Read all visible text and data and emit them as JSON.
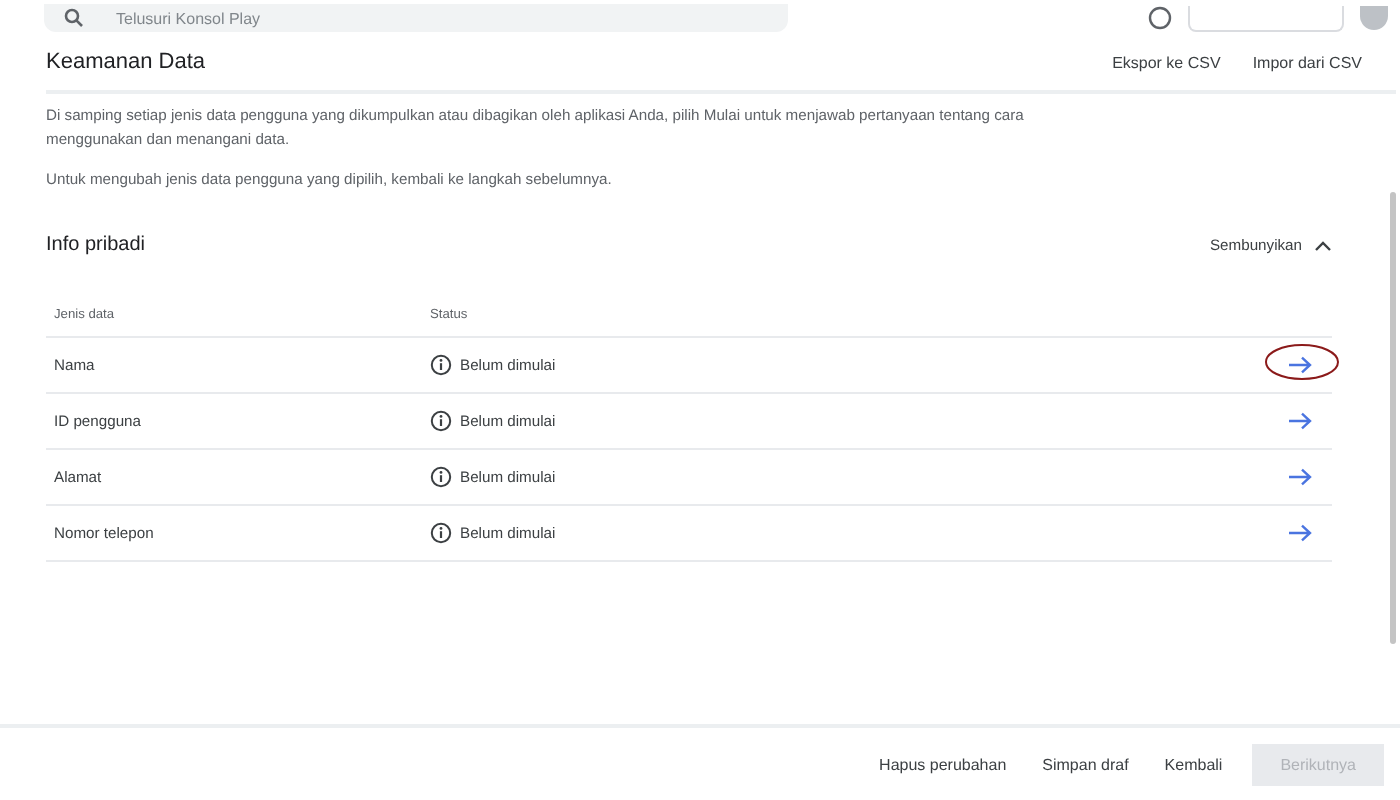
{
  "search": {
    "placeholder": "Telusuri Konsol Play"
  },
  "header": {
    "title": "Keamanan Data",
    "actions": [
      "Ekspor ke CSV",
      "Impor dari CSV"
    ]
  },
  "intro": [
    "Di samping setiap jenis data pengguna yang dikumpulkan atau dibagikan oleh aplikasi Anda, pilih Mulai untuk menjawab pertanyaan tentang cara menggunakan dan menangani data.",
    "Untuk mengubah jenis data pengguna yang dipilih, kembali ke langkah sebelumnya."
  ],
  "section": {
    "title": "Info pribadi",
    "toggle": "Sembunyikan",
    "expanded": true
  },
  "table": {
    "columns": [
      "Jenis data",
      "Status"
    ],
    "rows": [
      {
        "name": "Nama",
        "status": "Belum dimulai",
        "circled": true
      },
      {
        "name": "ID pengguna",
        "status": "Belum dimulai",
        "circled": false
      },
      {
        "name": "Alamat",
        "status": "Belum dimulai",
        "circled": false
      },
      {
        "name": "Nomor telepon",
        "status": "Belum dimulai",
        "circled": false
      }
    ]
  },
  "footer": {
    "buttons": [
      {
        "label": "Hapus perubahan",
        "disabled": false
      },
      {
        "label": "Simpan draf",
        "disabled": false
      },
      {
        "label": "Kembali",
        "disabled": false
      },
      {
        "label": "Berikutnya",
        "disabled": true
      }
    ]
  }
}
